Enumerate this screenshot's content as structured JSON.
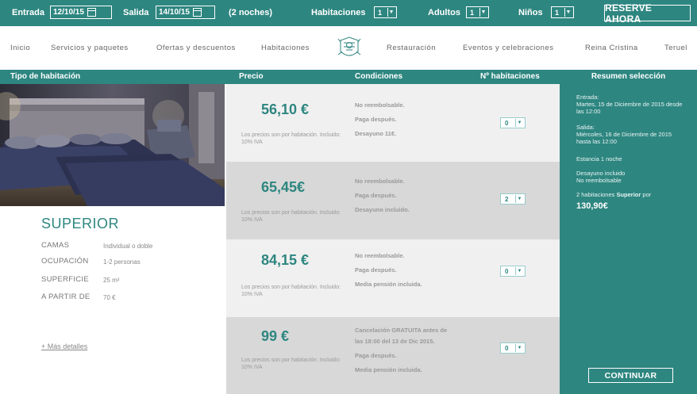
{
  "booking_bar": {
    "checkin_label": "Entrada",
    "checkin_value": "12/10/15",
    "checkout_label": "Salida",
    "checkout_value": "14/10/15",
    "nights": "(2 noches)",
    "rooms_label": "Habitaciones",
    "rooms_value": "1",
    "adults_label": "Adultos",
    "adults_value": "1",
    "children_label": "Niños",
    "children_value": "1",
    "reserve_label": "RESERVE AHORA"
  },
  "nav": {
    "items": [
      "Inicio",
      "Servicios y paquetes",
      "Ofertas y descuentos",
      "Habitaciones",
      "Restauración",
      "Eventos y celebraciones",
      "Reina Cristina",
      "Teruel"
    ]
  },
  "table_header": {
    "room_type": "Tipo de habitación",
    "price": "Precio",
    "conditions": "Condiciones",
    "num_rooms": "Nº habitaciones"
  },
  "room": {
    "name": "SUPERIOR",
    "specs": [
      {
        "label": "CAMAS",
        "value": "Individual o doble"
      },
      {
        "label": "OCUPACIÓN",
        "value": "1-2 personas"
      },
      {
        "label": "SUPERFICIE",
        "value": "25 m²"
      },
      {
        "label": "A PARTIR DE",
        "value": "70 €"
      }
    ],
    "more_link": "+ Más detalles"
  },
  "offers": [
    {
      "price": "56,10 €",
      "note": "Los precios son por habitación. Incluido: 10% IVA",
      "conditions": [
        "No reembolsable.",
        "Paga después.",
        "Desayuno 11€."
      ],
      "qty": "0"
    },
    {
      "price": "65,45€",
      "note": "Los precios son por habitación. Incluido: 10% IVA",
      "conditions": [
        "No reembolsable.",
        "Paga después.",
        "Desayuno incluido."
      ],
      "qty": "2"
    },
    {
      "price": "84,15 €",
      "note": "Los precios son por habitación. Incluido: 10% IVA",
      "conditions": [
        "No reembolsable.",
        "Paga después.",
        "Media pensión incluida."
      ],
      "qty": "0"
    },
    {
      "price": "99 €",
      "note": "Los precios son por habitación. Incluido: 10% IVA",
      "conditions": [
        "Cancelación GRATUITA antes de",
        "las 18:00 del 13 de Dic 2015.",
        "Paga después.",
        "Media pensión incluida."
      ],
      "qty": "0"
    }
  ],
  "summary": {
    "title": "Resumen selección",
    "checkin_label": "Entrada:",
    "checkin_text": "Martes, 15 de Diciembre de 2015 desde las 12:00",
    "checkout_label": "Salida:",
    "checkout_text": "Miércoles, 16 de Diciembre de 2015 hasta las 12:00",
    "stay": "Estancia 1 noche",
    "extras_1": "Desayuno incluido",
    "extras_2": "No reembolsable",
    "rooms_text": "2 habitaciones",
    "rooms_type": "Superior",
    "rooms_suffix": "por",
    "total": "130,90€",
    "continue_label": "CONTINUAR"
  },
  "colors": {
    "brand": "#2e8680",
    "row_light": "#f0f0f0",
    "row_dark": "#d8d8d8"
  }
}
